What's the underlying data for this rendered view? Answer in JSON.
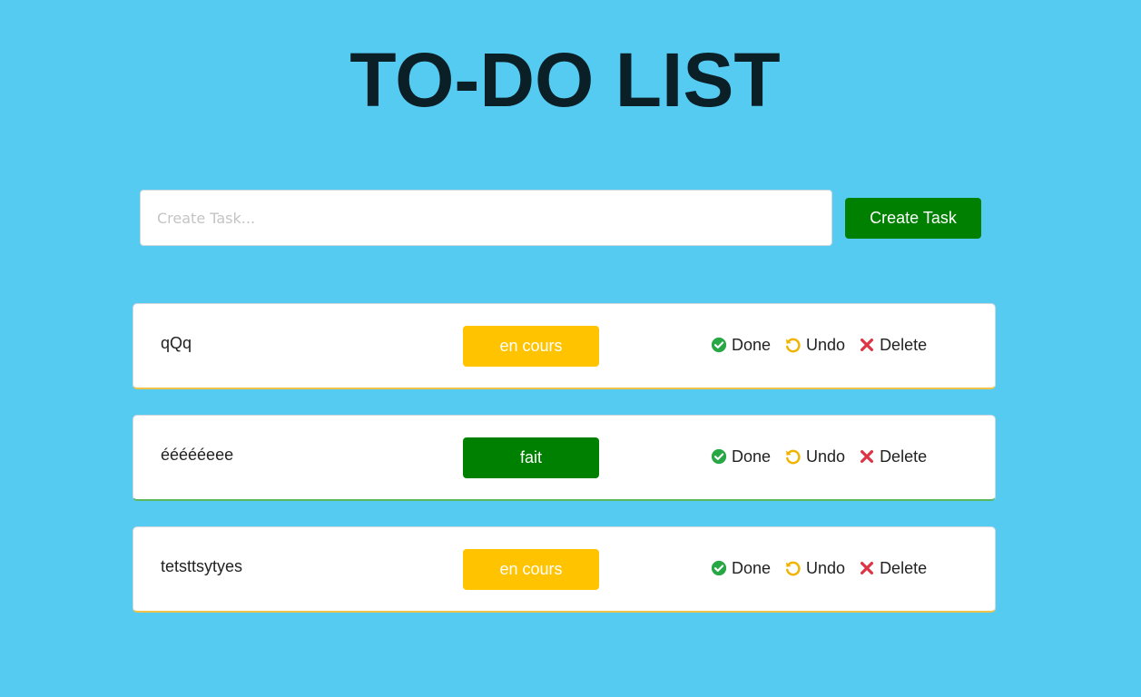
{
  "header": {
    "title": "TO-DO LIST"
  },
  "create": {
    "placeholder": "Create Task...",
    "value": "",
    "button_label": "Create Task"
  },
  "colors": {
    "background": "#55cbf2",
    "title": "#0b1f26",
    "create_button": "#008000",
    "status_en_cours": "#ffc300",
    "status_fait": "#008000",
    "done_icon": "#28a745",
    "undo_icon": "#f0b400",
    "delete_icon": "#dc3545"
  },
  "actions": {
    "done_label": "Done",
    "undo_label": "Undo",
    "delete_label": "Delete",
    "done_icon": "check-circle-icon",
    "undo_icon": "undo-icon",
    "delete_icon": "x-icon"
  },
  "tasks": [
    {
      "name": "qQq",
      "status": "en cours",
      "status_color": "#ffc300"
    },
    {
      "name": "éééééeee",
      "status": "fait",
      "status_color": "#008000"
    },
    {
      "name": "tetsttsytyes",
      "status": "en cours",
      "status_color": "#ffc300"
    }
  ]
}
